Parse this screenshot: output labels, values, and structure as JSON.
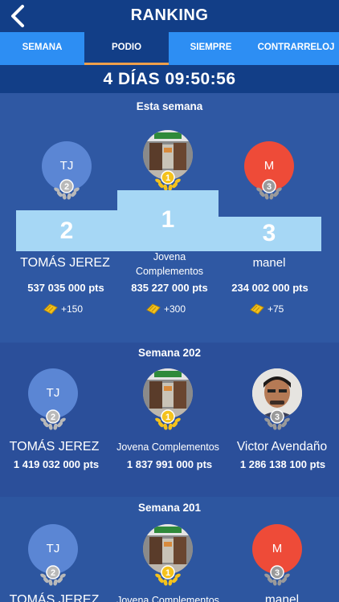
{
  "header": {
    "title": "RANKING"
  },
  "tabs": [
    {
      "label": "SEMANA"
    },
    {
      "label": "PODIO"
    },
    {
      "label": "SIEMPRE"
    },
    {
      "label": "CONTRARRELOJ"
    }
  ],
  "countdown": "4 DÍAS 09:50:56",
  "sections": [
    {
      "title": "Esta semana",
      "podium_numbers": [
        "2",
        "1",
        "3"
      ],
      "players": [
        {
          "name": "TOMÁS JEREZ",
          "initials": "TJ",
          "points": "537 035 000 pts",
          "reward": "+150",
          "rank": "2"
        },
        {
          "name": "Jovena Complementos",
          "initials": "",
          "points": "835 227 000 pts",
          "reward": "+300",
          "rank": "1"
        },
        {
          "name": "manel",
          "initials": "M",
          "points": "234 002 000 pts",
          "reward": "+75",
          "rank": "3"
        }
      ]
    },
    {
      "title": "Semana 202",
      "players": [
        {
          "name": "TOMÁS JEREZ",
          "initials": "TJ",
          "points": "1 419 032 000 pts",
          "rank": "2"
        },
        {
          "name": "Jovena Complementos",
          "initials": "",
          "points": "1 837 991 000 pts",
          "rank": "1"
        },
        {
          "name": "Victor Avendaño",
          "initials": "",
          "points": "1 286 138 100 pts",
          "rank": "3"
        }
      ]
    },
    {
      "title": "Semana 201",
      "players": [
        {
          "name": "TOMÁS JEREZ",
          "initials": "TJ",
          "rank": "2"
        },
        {
          "name": "Jovena Complementos",
          "initials": "",
          "rank": "1"
        },
        {
          "name": "manel",
          "initials": "M",
          "rank": "3"
        }
      ]
    }
  ],
  "colors": {
    "header": "#123e87",
    "tabs": "#2d8ef3",
    "active_tab_underline": "#f0a04b",
    "podium": "#a6d7f5",
    "avatar_blue": "#5b86d4",
    "avatar_red": "#ee4b38",
    "gold": "#f4c21c",
    "silver": "#b9b9b9",
    "bronze": "#9a9a9a"
  },
  "icons": [
    "back-arrow-icon",
    "medal-icon",
    "coin-icon"
  ]
}
